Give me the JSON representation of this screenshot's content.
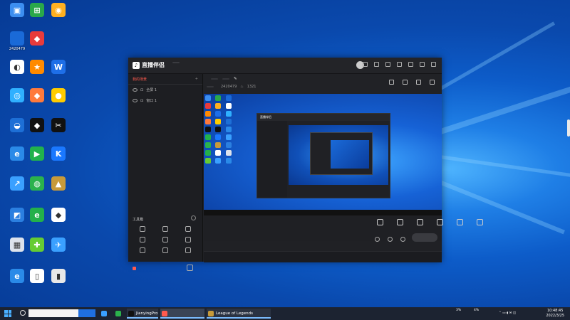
{
  "desktop_icons": [
    {
      "label": "",
      "color": "#3c8ef0",
      "glyph": "▣"
    },
    {
      "label": "",
      "color": "#2aa84a",
      "glyph": "⊞"
    },
    {
      "label": "2420479",
      "color": "#1a6ad8",
      "glyph": ""
    },
    {
      "label": "",
      "color": "#e83b3b",
      "glyph": "◆"
    },
    {
      "label": "",
      "color": "#ffb020",
      "glyph": "◉"
    },
    {
      "label": "",
      "color": "#ffffff",
      "glyph": "◐"
    },
    {
      "label": "",
      "color": "#ff8a00",
      "glyph": "★"
    },
    {
      "label": "",
      "color": "#1e6fe8",
      "glyph": "W"
    },
    {
      "label": "",
      "color": "#2fb0ff",
      "glyph": "◎"
    },
    {
      "label": "",
      "color": "#ff7a3c",
      "glyph": "◆"
    },
    {
      "label": "",
      "color": "#ffcc00",
      "glyph": "●"
    },
    {
      "label": "",
      "color": "#1d6fd6",
      "glyph": "◒"
    },
    {
      "label": "",
      "color": "#111111",
      "glyph": "◆"
    },
    {
      "label": "",
      "color": "#111111",
      "glyph": "✂"
    },
    {
      "label": "",
      "color": "#2a8ae8",
      "glyph": "e"
    },
    {
      "label": "",
      "color": "#22b24c",
      "glyph": "▶"
    },
    {
      "label": "",
      "color": "#1a78ff",
      "glyph": "K"
    },
    {
      "label": "",
      "color": "#3aa0ff",
      "glyph": "↗"
    },
    {
      "label": "",
      "color": "#2bb24c",
      "glyph": "◍"
    },
    {
      "label": "",
      "color": "#c79a3a",
      "glyph": "▲"
    },
    {
      "label": "",
      "color": "#2b7fe0",
      "glyph": "◩"
    },
    {
      "label": "",
      "color": "#23b04a",
      "glyph": "e"
    },
    {
      "label": "",
      "color": "#ffffff",
      "glyph": "◆"
    },
    {
      "label": "",
      "color": "#dde3ec",
      "glyph": "▦"
    },
    {
      "label": "",
      "color": "#66cc33",
      "glyph": "✚"
    },
    {
      "label": "",
      "color": "#3aa0ff",
      "glyph": "✈"
    },
    {
      "label": "",
      "color": "#2a8ae8",
      "glyph": "e"
    },
    {
      "label": "",
      "color": "#ffffff",
      "glyph": "▯"
    },
    {
      "label": "",
      "color": "#e8e8e8",
      "glyph": "▮"
    }
  ],
  "app": {
    "logo_text": "直播伴侣",
    "beta": "",
    "sidebar_tabs": [
      "我的场景",
      "",
      ""
    ],
    "scenes": [
      "全屏 1",
      "窗口 1"
    ],
    "tools_title": "工具箱",
    "tools": [
      "",
      "",
      "",
      "",
      "",
      "",
      "",
      "",
      ""
    ],
    "footer_text": "",
    "head_title": "",
    "head_pill": "",
    "head_pill2": "",
    "head_row2": [
      "",
      "",
      "2420479",
      "1321"
    ],
    "controls": [
      "",
      "",
      "",
      "",
      "",
      ""
    ],
    "golive": "",
    "status": [
      "",
      "",
      "",
      "",
      ""
    ]
  },
  "taskbar": {
    "search_text": "",
    "search_button": "",
    "apps": [
      {
        "label": "",
        "color": "#3aa0ff",
        "state": ""
      },
      {
        "label": "",
        "color": "#2bb24c",
        "state": ""
      },
      {
        "label": "JianyingPro",
        "color": "#111111",
        "state": "open"
      },
      {
        "label": "",
        "color": "#ff5a4e",
        "state": "active"
      },
      {
        "label": "League of Legends",
        "color": "#c79a3a",
        "state": "open"
      }
    ],
    "cpu1": "3%",
    "cpu1_label": "",
    "cpu2": "4%",
    "cpu2_label": "",
    "time": "10:48:45",
    "date": "2022/3/25"
  }
}
